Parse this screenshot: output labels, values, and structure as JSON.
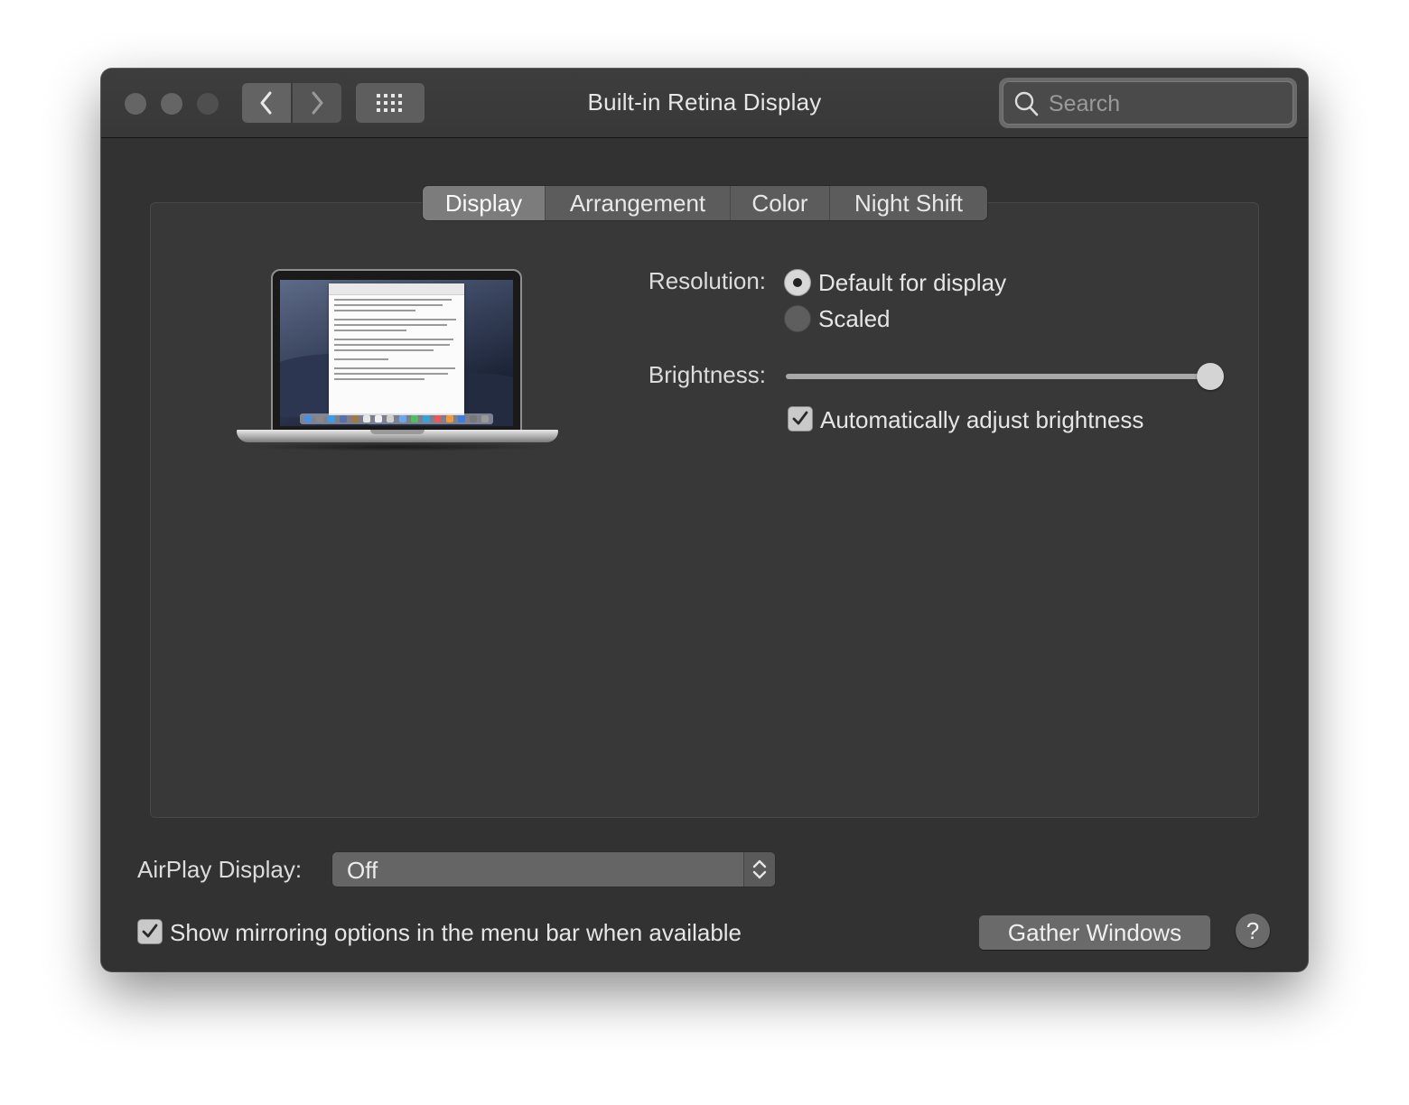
{
  "window": {
    "title": "Built-in Retina Display",
    "search": {
      "placeholder": "Search",
      "value": ""
    }
  },
  "toolbar": {
    "back_icon": "chevron-left-icon",
    "forward_icon": "chevron-right-icon",
    "show_all_icon": "grid-icon"
  },
  "tabs": [
    {
      "label": "Display",
      "selected": true
    },
    {
      "label": "Arrangement",
      "selected": false
    },
    {
      "label": "Color",
      "selected": false
    },
    {
      "label": "Night Shift",
      "selected": false
    }
  ],
  "display": {
    "resolution_label": "Resolution:",
    "resolution_options": [
      {
        "label": "Default for display",
        "selected": true
      },
      {
        "label": "Scaled",
        "selected": false
      }
    ],
    "brightness_label": "Brightness:",
    "brightness_value": 1.0,
    "auto_brightness_label": "Automatically adjust brightness",
    "auto_brightness_checked": true
  },
  "airplay": {
    "label": "AirPlay Display:",
    "selected": "Off"
  },
  "mirroring": {
    "label": "Show mirroring options in the menu bar when available",
    "checked": true
  },
  "buttons": {
    "gather_windows": "Gather Windows",
    "help": "?"
  },
  "colors": {
    "window_bg": "#323232",
    "titlebar_bg": "#3a3a3a",
    "control_bg": "#656565",
    "text": "#e6e6e6"
  }
}
